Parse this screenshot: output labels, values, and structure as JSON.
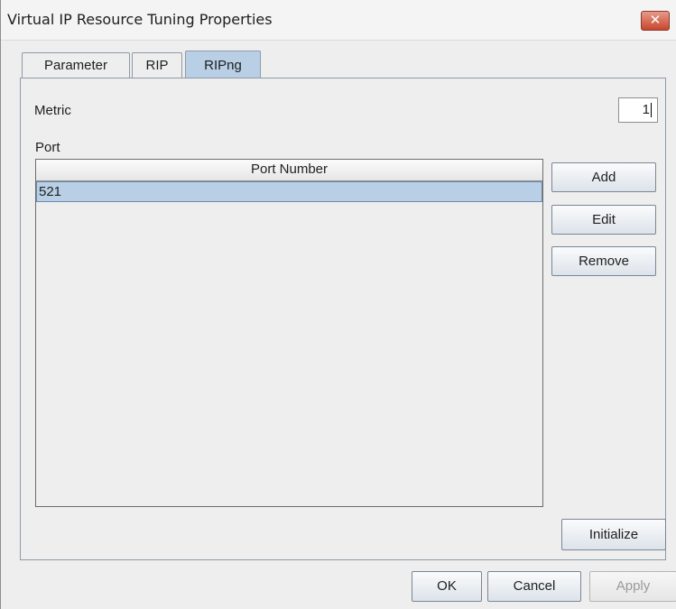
{
  "window": {
    "title": "Virtual IP Resource Tuning Properties",
    "close_label": "✕"
  },
  "tabs": [
    {
      "label": "Parameter",
      "selected": false
    },
    {
      "label": "RIP",
      "selected": false
    },
    {
      "label": "RIPng",
      "selected": true
    }
  ],
  "metric": {
    "label": "Metric",
    "value": "1"
  },
  "port": {
    "label": "Port",
    "table": {
      "columns": [
        "Port Number"
      ],
      "rows": [
        [
          "521"
        ]
      ]
    },
    "buttons": {
      "add": "Add",
      "edit": "Edit",
      "remove": "Remove"
    }
  },
  "initialize_label": "Initialize",
  "footer": {
    "ok": "OK",
    "cancel": "Cancel",
    "apply": "Apply"
  },
  "colors": {
    "selection": "#b8cfe5",
    "close_button": "#c9452d"
  }
}
